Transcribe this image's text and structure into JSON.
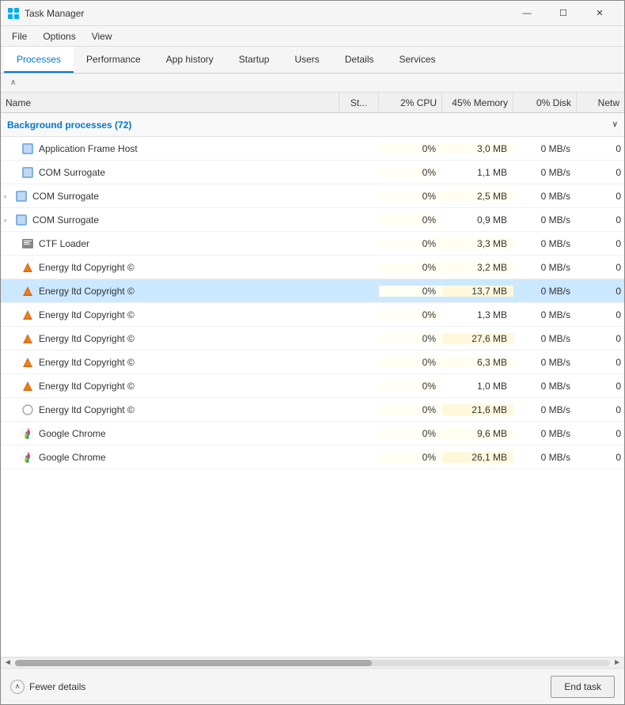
{
  "window": {
    "title": "Task Manager",
    "controls": {
      "minimize": "—",
      "maximize": "☐",
      "close": "✕"
    }
  },
  "menubar": {
    "items": [
      "File",
      "Options",
      "View"
    ]
  },
  "tabs": {
    "items": [
      {
        "id": "processes",
        "label": "Processes",
        "active": true
      },
      {
        "id": "performance",
        "label": "Performance",
        "active": false
      },
      {
        "id": "app-history",
        "label": "App history",
        "active": false
      },
      {
        "id": "startup",
        "label": "Startup",
        "active": false
      },
      {
        "id": "users",
        "label": "Users",
        "active": false
      },
      {
        "id": "details",
        "label": "Details",
        "active": false
      },
      {
        "id": "services",
        "label": "Services",
        "active": false
      }
    ]
  },
  "columns": {
    "sort_arrow": "∧",
    "name": "Name",
    "status": "St...",
    "cpu": "CPU",
    "cpu_pct": "2%",
    "memory": "Memory",
    "memory_pct": "45%",
    "disk": "Disk",
    "disk_pct": "0%",
    "network": "Netw"
  },
  "sections": {
    "background": {
      "label": "Background processes (72)",
      "collapse_arrow": "∨"
    }
  },
  "processes": [
    {
      "name": "Application Frame Host",
      "icon": "🖥",
      "status": "",
      "cpu": "0%",
      "memory": "3,0 MB",
      "disk": "0 MB/s",
      "net": "0",
      "expandable": false,
      "selected": false,
      "highlighted": false
    },
    {
      "name": "COM Surrogate",
      "icon": "🖥",
      "status": "",
      "cpu": "0%",
      "memory": "1,1 MB",
      "disk": "0 MB/s",
      "net": "0",
      "expandable": false,
      "selected": false,
      "highlighted": false
    },
    {
      "name": "COM Surrogate",
      "icon": "🖥",
      "status": "",
      "cpu": "0%",
      "memory": "2,5 MB",
      "disk": "0 MB/s",
      "net": "0",
      "expandable": true,
      "selected": false,
      "highlighted": false
    },
    {
      "name": "COM Surrogate",
      "icon": "🖥",
      "status": "",
      "cpu": "0%",
      "memory": "0,9 MB",
      "disk": "0 MB/s",
      "net": "0",
      "expandable": true,
      "selected": false,
      "highlighted": false
    },
    {
      "name": "CTF Loader",
      "icon": "📋",
      "status": "",
      "cpu": "0%",
      "memory": "3,3 MB",
      "disk": "0 MB/s",
      "net": "0",
      "expandable": false,
      "selected": false,
      "highlighted": false
    },
    {
      "name": "Energy ltd Copyright ©",
      "icon": "💎",
      "status": "",
      "cpu": "0%",
      "memory": "3,2 MB",
      "disk": "0 MB/s",
      "net": "0",
      "expandable": false,
      "selected": false,
      "highlighted": false
    },
    {
      "name": "Energy ltd Copyright ©",
      "icon": "💎",
      "status": "",
      "cpu": "0%",
      "memory": "13,7 MB",
      "disk": "0 MB/s",
      "net": "0",
      "expandable": false,
      "selected": true,
      "highlighted": false
    },
    {
      "name": "Energy ltd Copyright ©",
      "icon": "💎",
      "status": "",
      "cpu": "0%",
      "memory": "1,3 MB",
      "disk": "0 MB/s",
      "net": "0",
      "expandable": false,
      "selected": false,
      "highlighted": false
    },
    {
      "name": "Energy ltd Copyright ©",
      "icon": "💎",
      "status": "",
      "cpu": "0%",
      "memory": "27,6 MB",
      "disk": "0 MB/s",
      "net": "0",
      "expandable": false,
      "selected": false,
      "highlighted": false
    },
    {
      "name": "Energy ltd Copyright ©",
      "icon": "💎",
      "status": "",
      "cpu": "0%",
      "memory": "6,3 MB",
      "disk": "0 MB/s",
      "net": "0",
      "expandable": false,
      "selected": false,
      "highlighted": false
    },
    {
      "name": "Energy ltd Copyright ©",
      "icon": "💎",
      "status": "",
      "cpu": "0%",
      "memory": "1,0 MB",
      "disk": "0 MB/s",
      "net": "0",
      "expandable": false,
      "selected": false,
      "highlighted": false
    },
    {
      "name": "Energy ltd Copyright ©",
      "icon": "○",
      "status": "",
      "cpu": "0%",
      "memory": "21,6 MB",
      "disk": "0 MB/s",
      "net": "0",
      "expandable": false,
      "selected": false,
      "highlighted": false
    },
    {
      "name": "Google Chrome",
      "icon": "🌐",
      "status": "",
      "cpu": "0%",
      "memory": "9,6 MB",
      "disk": "0 MB/s",
      "net": "0",
      "expandable": false,
      "selected": false,
      "highlighted": false
    },
    {
      "name": "Google Chrome",
      "icon": "🌐",
      "status": "",
      "cpu": "0%",
      "memory": "26,1 MB",
      "disk": "0 MB/s",
      "net": "0",
      "expandable": false,
      "selected": false,
      "highlighted": false
    }
  ],
  "footer": {
    "fewer_details": "Fewer details",
    "end_task": "End task"
  }
}
